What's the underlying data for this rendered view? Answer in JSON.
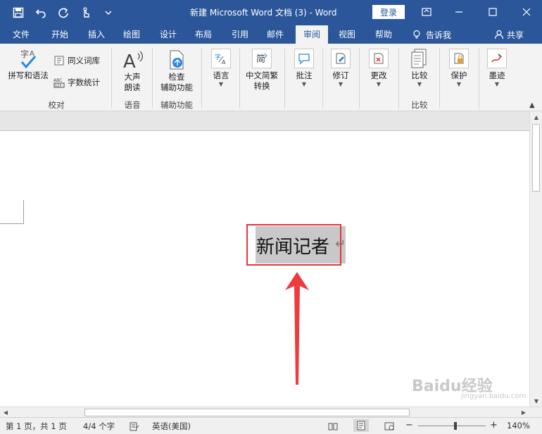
{
  "window": {
    "title": "新建 Microsoft Word 文档 (3)  -  Word",
    "login_label": "登录"
  },
  "tabs": [
    "文件",
    "开始",
    "插入",
    "绘图",
    "设计",
    "布局",
    "引用",
    "邮件",
    "审阅",
    "视图",
    "帮助"
  ],
  "active_tab": "审阅",
  "tell_me": "告诉我",
  "share": "共享",
  "ribbon": {
    "spelling": "拼写和语法",
    "thesaurus": "同义词库",
    "word_count": "字数统计",
    "proofing_group": "校对",
    "read_aloud_1": "大声",
    "read_aloud_2": "朗读",
    "speech_group": "语音",
    "check_access_1": "检查",
    "check_access_2": "辅助功能",
    "access_group": "辅助功能",
    "language": "语言",
    "chinese_conv_1": "中文简繁",
    "chinese_conv_2": "转换",
    "comments": "批注",
    "track": "修订",
    "changes": "更改",
    "compare": "比较",
    "compare_group": "比较",
    "protect": "保护",
    "ink": "墨迹"
  },
  "document": {
    "text": "新闻记者",
    "para_mark": "↵"
  },
  "statusbar": {
    "page": "第 1 页，共 1 页",
    "words": "4/4 个字",
    "language": "英语(美国)",
    "zoom": "140%",
    "zoom_minus": "−",
    "zoom_plus": "+"
  },
  "watermark": {
    "brand": "Baidu经验",
    "url": "jingyan.baidu.com"
  },
  "colors": {
    "brand": "#2b579a",
    "highlight_box": "#e8333a",
    "ribbon_bg": "#f3f3f3"
  }
}
